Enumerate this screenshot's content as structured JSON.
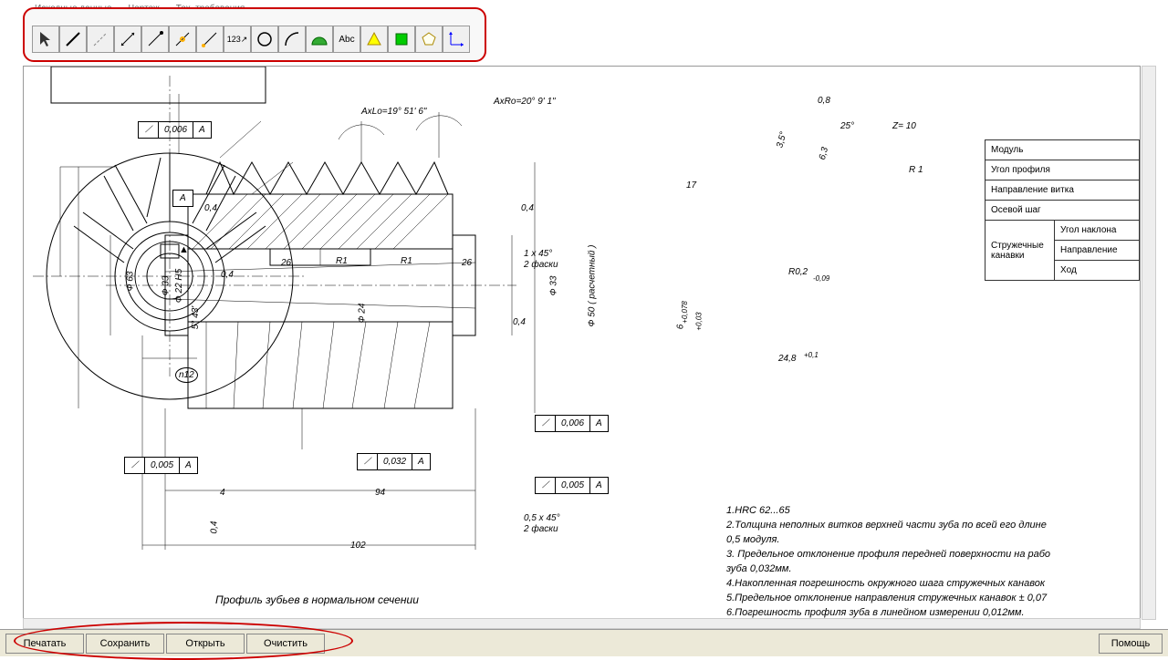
{
  "tabs": {
    "t1": "Исходные данные",
    "t2": "Чертеж",
    "t3": "Тех. требования"
  },
  "tools": [
    "pointer",
    "line",
    "axis",
    "dim-lin",
    "dim-rad",
    "dim-diam",
    "dim-ang",
    "leader",
    "circle",
    "arc",
    "protractor",
    "text",
    "triangle",
    "square",
    "pentagon",
    "coord"
  ],
  "tolerance_boxes": {
    "tb1": {
      "v": "0,006",
      "d": "А"
    },
    "tb2": {
      "v": "0,005",
      "d": "А"
    },
    "tb3": {
      "v": "0,032",
      "d": "А"
    },
    "tb4": {
      "v": "0,006",
      "d": "А"
    },
    "tb5": {
      "v": "0,005",
      "d": "А"
    }
  },
  "letters": {
    "A1": "А",
    "A2": "А"
  },
  "dims": {
    "axlo": "АxLo=19° 51' 6\"",
    "axro": "АxRo=20° 9' 1\"",
    "d63": "Ф 63",
    "d33": "Ф 33",
    "d22": "Ф 22 Н5",
    "d24": "Ф 24",
    "d33r": "Ф 33",
    "d50": "Ф 50 ( расчетный )",
    "l26a": "26",
    "l26b": "26",
    "r1a": "R1",
    "r1b": "R1",
    "a04a": "0,4",
    "a04b": "0,4",
    "a04c": "0,4",
    "a04d": "0,4",
    "a04e": "0,4",
    "ang543": "5° 43'",
    "n12": "n12",
    "l4": "4",
    "l94": "94",
    "l102": "102",
    "ch1": "1 x 45°",
    "ch1s": "2 фаски",
    "ch05": "0,5 x 45°",
    "ch05s": "2 фаски",
    "front_08": "0,8",
    "front_25": "25°",
    "front_35": "3,5°",
    "front_63": "6,3",
    "front_17": "17",
    "front_z": "Z=  10",
    "front_r1": "R 1",
    "front_r02": "R0,2",
    "front_009": "-0,09",
    "front_6": "6",
    "front_6t1": "+0,078",
    "front_6t2": "+0,03",
    "front_248": "24,8",
    "front_248t": "+0,1"
  },
  "param_table": {
    "r1": "Модуль",
    "r2": "Угол профиля",
    "r3": "Направление витка",
    "r4": "Осевой шаг",
    "r5": "Стружечные канавки",
    "r5a": "Угол наклона",
    "r5b": "Направление",
    "r5c": "Ход"
  },
  "notes": {
    "n1": "1.HRC 62...65",
    "n2": "2.Толщина неполных витков верхней части зуба по всей его длине",
    "n2b": "0,5 модуля.",
    "n3": "3. Предельное отклонение профиля передней поверхности на рабо",
    "n3b": "зуба 0,032мм.",
    "n4": "4.Накопленная погрешность окружного шага стружечных канавок",
    "n5": "5.Предельное отклонение направления стружечных канавок ± 0,07",
    "n6": "6.Погрешность профиля зуба в линейном измерении 0,012мм."
  },
  "caption": "Профиль зубьев в нормальном сечении",
  "buttons": {
    "print": "Печатать",
    "save": "Сохранить",
    "open": "Открыть",
    "clear": "Очистить",
    "help": "Помощь"
  }
}
